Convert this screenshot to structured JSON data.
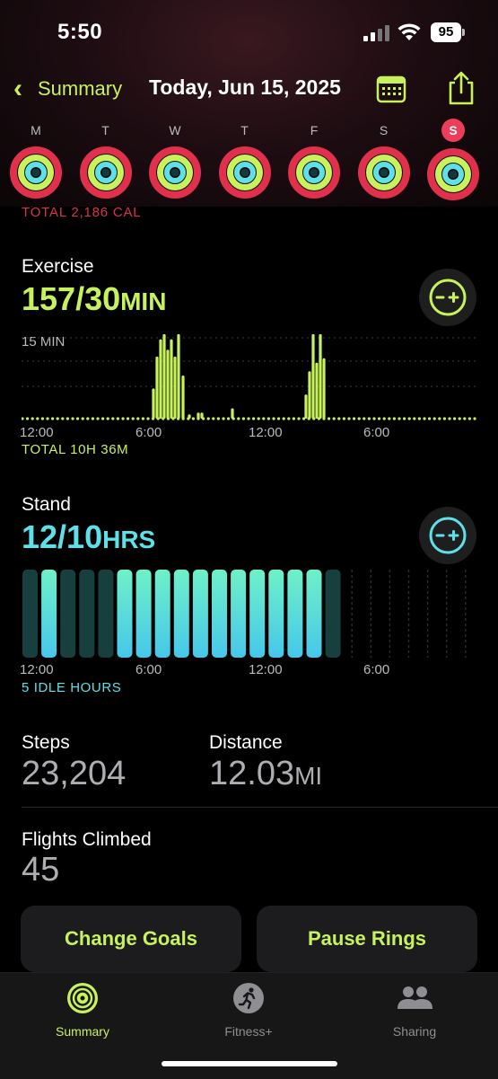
{
  "status_bar": {
    "time": "5:50",
    "battery": "95"
  },
  "nav": {
    "back_label": "Summary",
    "title": "Today, Jun 15, 2025"
  },
  "week": {
    "days": [
      {
        "letter": "M",
        "selected": false
      },
      {
        "letter": "T",
        "selected": false
      },
      {
        "letter": "W",
        "selected": false
      },
      {
        "letter": "T",
        "selected": false
      },
      {
        "letter": "F",
        "selected": false
      },
      {
        "letter": "S",
        "selected": false
      },
      {
        "letter": "S",
        "selected": true
      }
    ]
  },
  "move": {
    "total": "TOTAL 2,186 CAL"
  },
  "exercise": {
    "title": "Exercise",
    "value": "157/30",
    "unit": "MIN",
    "scale_label": "15 MIN",
    "axis": [
      "12:00",
      "6:00",
      "12:00",
      "6:00"
    ],
    "total": "TOTAL 10H 36M"
  },
  "stand": {
    "title": "Stand",
    "value": "12/10",
    "unit": "HRS",
    "axis": [
      "12:00",
      "6:00",
      "12:00",
      "6:00"
    ],
    "idle": "5 IDLE HOURS",
    "hours_stood": [
      0,
      1,
      0,
      0,
      0,
      1,
      1,
      1,
      1,
      1,
      1,
      1,
      1,
      1,
      1,
      1,
      0
    ]
  },
  "steps": {
    "label": "Steps",
    "value": "23,204"
  },
  "distance": {
    "label": "Distance",
    "value": "12.03",
    "unit": "MI"
  },
  "flights": {
    "label": "Flights Climbed",
    "value": "45"
  },
  "buttons": {
    "change_goals": "Change Goals",
    "pause_rings": "Pause Rings"
  },
  "tabs": [
    {
      "label": "Summary",
      "icon": "rings-icon",
      "active": true
    },
    {
      "label": "Fitness+",
      "icon": "runner-icon",
      "active": false
    },
    {
      "label": "Sharing",
      "icon": "people-icon",
      "active": false
    }
  ],
  "colors": {
    "accent": "#c7f25c",
    "move": "#e0304c",
    "stand": "#5de0e8"
  }
}
